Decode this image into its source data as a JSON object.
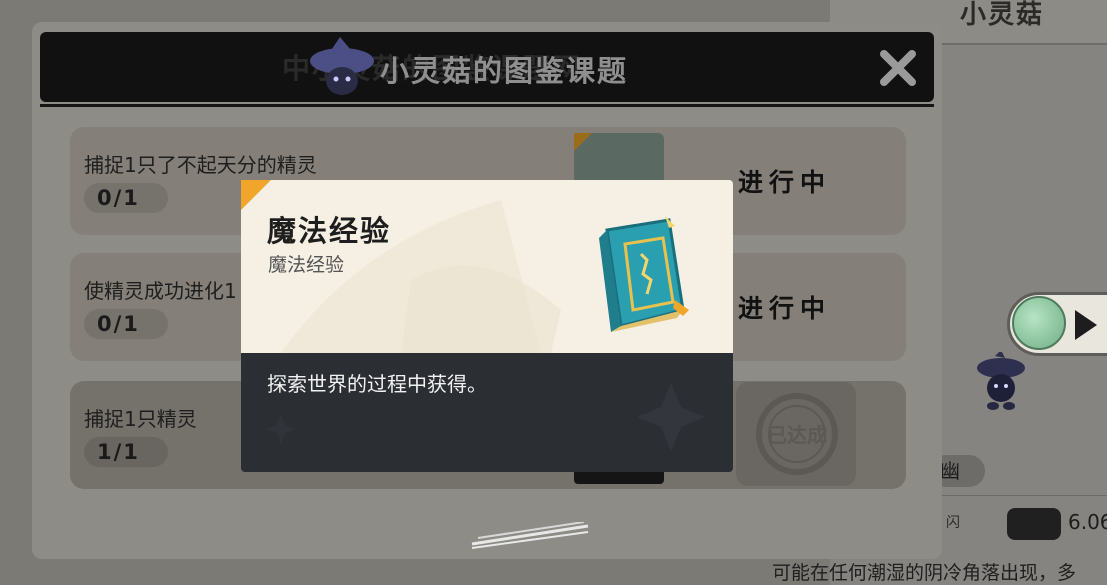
{
  "background": {
    "right_title": "小灵菇",
    "chip_text": "幽",
    "small_label": "闪",
    "price": "6.06",
    "bottom_text": "可能在任何潮湿的阴冷角落出现，多"
  },
  "panel": {
    "title": "小灵菇的图鉴课题",
    "ghost_title": "中小灵菇的图鉴课题网",
    "close_icon": "close-x-icon"
  },
  "tasks": [
    {
      "name": "捕捉1只了不起天分的精灵",
      "progress": "0/1",
      "status": "进行中",
      "completed": false
    },
    {
      "name": "使精灵成功进化1",
      "progress": "0/1",
      "status": "进行中",
      "completed": false
    },
    {
      "name": "捕捉1只精灵",
      "progress": "1/1",
      "status": "已达成",
      "completed": true
    }
  ],
  "tooltip": {
    "title": "魔法经验",
    "subtitle": "魔法经验",
    "description": "探索世界的过程中获得。",
    "icon": "magic-book-icon",
    "accent": "#f0a62a"
  },
  "colors": {
    "header_bg": "#111111",
    "card_top_bg": "#f6f0e4",
    "card_bottom_bg": "#2b2e33"
  }
}
